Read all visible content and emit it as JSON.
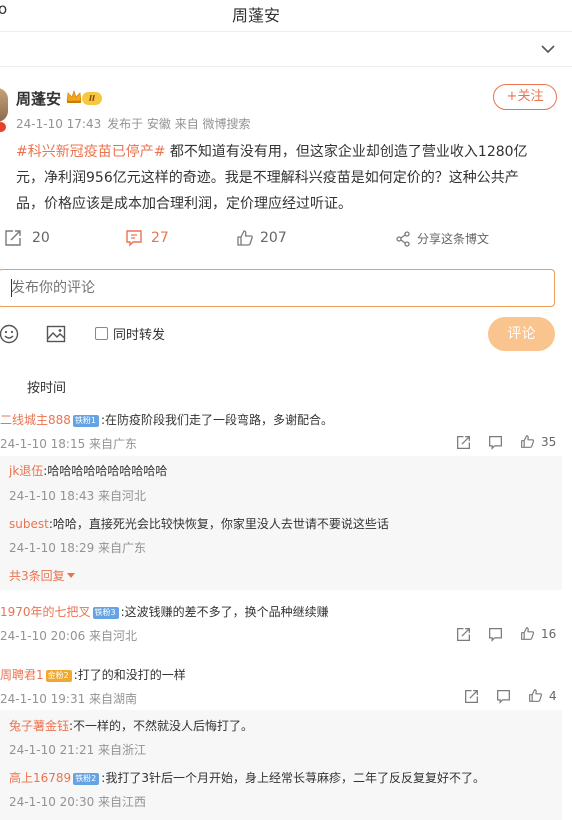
{
  "header": {
    "back_glyph": "o",
    "title": "周蓬安"
  },
  "post": {
    "author": "周蓬安",
    "level_badge": "II",
    "time": "24-1-10 17:43",
    "source": "发布于 安徽 来自 微博搜索",
    "follow_label": "+关注",
    "hashtag": "#科兴新冠疫苗已停产#",
    "text_line1": " 都不知道有没有用，但这家企业却创造了营业收入1280亿",
    "text_line2": "元，净利润956亿元这样的奇迹。我是不理解科兴疫苗是如何定价的？这种公共产",
    "text_line3": "品，价格应该是成本加合理利润，定价理应经过听证。",
    "reposts": "20",
    "comments": "27",
    "likes": "207",
    "share_label": "分享这条博文"
  },
  "composer": {
    "placeholder": "发布你的评论",
    "repost_label": "同时转发",
    "submit_label": "评论"
  },
  "sort_label": "按时间",
  "comments": [
    {
      "user": "二线城主888",
      "badge": "铁粉1",
      "text": ":在防疫阶段我们走了一段弯路，多谢配合。",
      "meta": "24-1-10 18:15 来自广东",
      "likes": "35",
      "replies": [
        {
          "user": "jk退伍",
          "text": ":哈哈哈哈哈哈哈哈哈哈",
          "meta": "24-1-10 18:43 来自河北"
        },
        {
          "user": "subest",
          "text": ":哈哈，直接死光会比较快恢复，你家里没人去世请不要说这些话",
          "meta": "24-1-10 18:29 来自广东"
        }
      ],
      "more_replies": "共3条回复"
    },
    {
      "user": "1970年的七把叉",
      "badge": "铁粉3",
      "text": ":这波钱赚的差不多了，换个品种继续赚",
      "meta": "24-1-10 20:06 来自河北",
      "likes": "16"
    },
    {
      "user": "周聘君1",
      "badge": "金粉2",
      "text": ":打了的和没打的一样",
      "meta": "24-1-10 19:31 来自湖南",
      "likes": "4",
      "replies": [
        {
          "user": "兔子薯金钰",
          "text": ":不一样的，不然就没人后悔打了。",
          "meta": "24-1-10 21:21 来自浙江"
        },
        {
          "user": "高上16789",
          "badge": "铁粉2",
          "text": ":我打了3针后一个月开始，身上经常长荨麻疹，二年了反反复复好不了。",
          "meta": "24-1-10 20:30 来自江西"
        }
      ]
    }
  ],
  "colors": {
    "accent": "#eb7350",
    "link": "#eb7350",
    "badge_blue": "#66a3e3",
    "badge_gold": "#f0a830",
    "submit_bg": "#f9c48d"
  }
}
